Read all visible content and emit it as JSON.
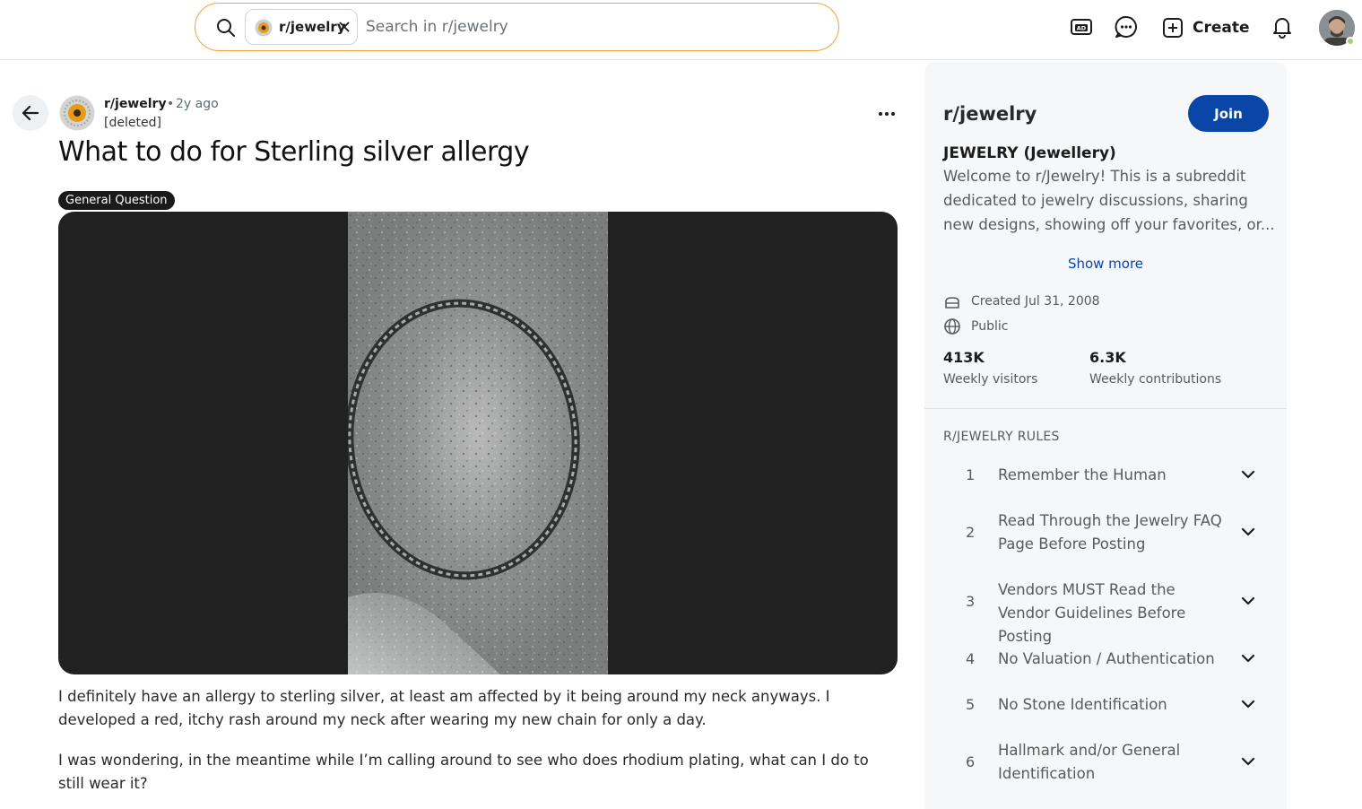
{
  "search": {
    "chip_label": "r/jewelry",
    "placeholder": "Search in r/jewelry",
    "icon": "search-icon"
  },
  "header": {
    "icons": [
      "advertise-icon",
      "chat-icon",
      "plus-square-icon",
      "bell-icon"
    ],
    "create_label": "Create"
  },
  "post": {
    "subreddit": "r/jewelry",
    "separator": "•",
    "time": "2y ago",
    "author": "[deleted]",
    "title": "What to do for Sterling silver allergy",
    "flair": "General Question",
    "body": [
      "I definitely have an allergy to sterling silver, at least am affected by it being around my neck anyways. I developed a red, itchy rash around my neck after wearing my new chain for only a day.",
      "I was wondering, in the meantime while I’m calling around to see who does rhodium plating, what can I do to still wear it?"
    ]
  },
  "sidebar": {
    "title": "r/jewelry",
    "join_label": "Join",
    "heading": "JEWELRY (Jewellery)",
    "description": "Welcome to r/Jewelry! This is a subreddit dedicated to jewelry discussions, sharing new designs, showing off your favorites, or...",
    "show_more": "Show more",
    "created": "Created Jul 31, 2008",
    "visibility": "Public",
    "stats": [
      {
        "value": "413K",
        "label": "Weekly visitors"
      },
      {
        "value": "6.3K",
        "label": "Weekly contributions"
      }
    ],
    "rules_title": "R/JEWELRY RULES",
    "rules": [
      {
        "num": "1",
        "text": "Remember the Human"
      },
      {
        "num": "2",
        "text": "Read Through the Jewelry FAQ Page Before Posting"
      },
      {
        "num": "3",
        "text": "Vendors MUST Read the Vendor Guidelines Before Posting"
      },
      {
        "num": "4",
        "text": "No Valuation / Authentication"
      },
      {
        "num": "5",
        "text": "No Stone Identification"
      },
      {
        "num": "6",
        "text": "Hallmark and/or General Identification"
      }
    ]
  },
  "colors": {
    "accent": "#0a45a8",
    "search_border": "#f2a33a",
    "flair_bg": "#1a1a1b",
    "media_bg": "#212121",
    "sidebar_bg": "#f6f7f8"
  }
}
